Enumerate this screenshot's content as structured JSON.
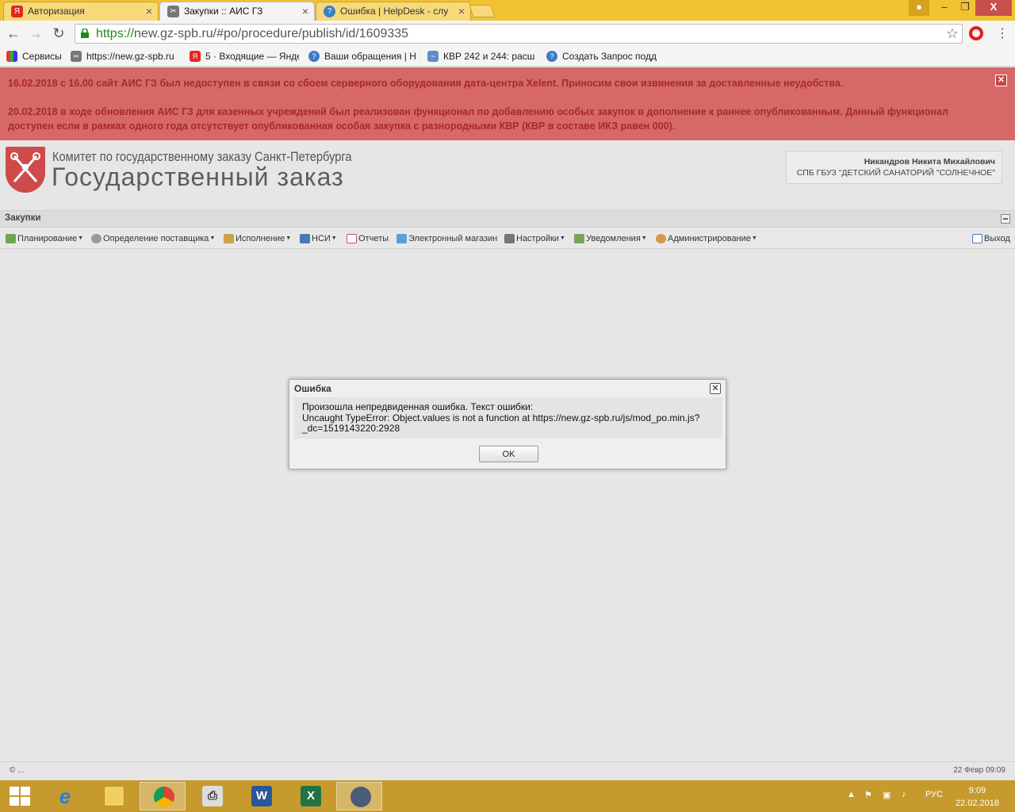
{
  "browser": {
    "tabs": [
      {
        "title": "Авторизация",
        "active": false
      },
      {
        "title": "Закупки :: АИС ГЗ",
        "active": true
      },
      {
        "title": "Ошибка | HelpDesk - слу",
        "active": false
      }
    ],
    "url_scheme": "https://",
    "url_rest": "new.gz-spb.ru/#po/procedure/publish/id/1609335",
    "bookmarks": [
      {
        "label": "Сервисы"
      },
      {
        "label": "https://new.gz-spb.ru"
      },
      {
        "label": "5 · Входящие — Янде"
      },
      {
        "label": "Ваши обращения | H"
      },
      {
        "label": "КВР 242 и 244: расш"
      },
      {
        "label": "Создать Запрос подд"
      }
    ],
    "window_close": "X"
  },
  "alert": {
    "line1": "16.02.2018 с 16.00 сайт АИС ГЗ был недоступен в связи со сбоем серверного оборудования дата-центра Xelent. Приносим свои извинения за доставленные неудобства.",
    "line2": "20.02.2018 в ходе обновления АИС ГЗ для казенных учреждений был реализован функционал по добавлению особых закупок в дополнение к раннее опубликованным. Данный функционал доступен если в рамках одного года отсутствует опубликованная особая закупка с разнородными КВР (КВР в составе ИКЗ равен 000).",
    "close": "✕"
  },
  "header": {
    "committee": "Комитет по государственному заказу Санкт-Петербурга",
    "title": "Государственный заказ",
    "user_name": "Никандров Никита Михайлович",
    "user_org": "СПБ ГБУЗ \"ДЕТСКИЙ САНАТОРИЙ \"СОЛНЕЧНОЕ\""
  },
  "panel": {
    "title": "Закупки"
  },
  "menu": {
    "items": [
      {
        "label": "Планирование",
        "dropdown": true
      },
      {
        "label": "Определение поставщика",
        "dropdown": true
      },
      {
        "label": "Исполнение",
        "dropdown": true
      },
      {
        "label": "НСИ",
        "dropdown": true
      },
      {
        "label": "Отчеты",
        "dropdown": false
      },
      {
        "label": "Электронный магазин",
        "dropdown": false
      },
      {
        "label": "Настройки",
        "dropdown": true
      },
      {
        "label": "Уведомления",
        "dropdown": true
      },
      {
        "label": "Администрирование",
        "dropdown": true
      }
    ],
    "logout": "Выход"
  },
  "dialog": {
    "title": "Ошибка",
    "line1": "Произошла непредвиденная ошибка. Текст ошибки:",
    "line2": "Uncaught TypeError: Object.values is not a function at https://new.gz-spb.ru/js/mod_po.min.js?",
    "line3": "_dc=1519143220:2928",
    "ok": "OK",
    "close": "✕"
  },
  "footer": {
    "copy": "© ...",
    "date": "22 Февр 09:09"
  },
  "taskbar": {
    "lang": "РУС",
    "time": "9:09",
    "date": "22.02.2018"
  },
  "colors": {
    "alert_bg": "#d66868",
    "alert_text": "#a72a2a",
    "taskbar": "#c79a2d",
    "chrome_tabbar": "#f1c232"
  }
}
